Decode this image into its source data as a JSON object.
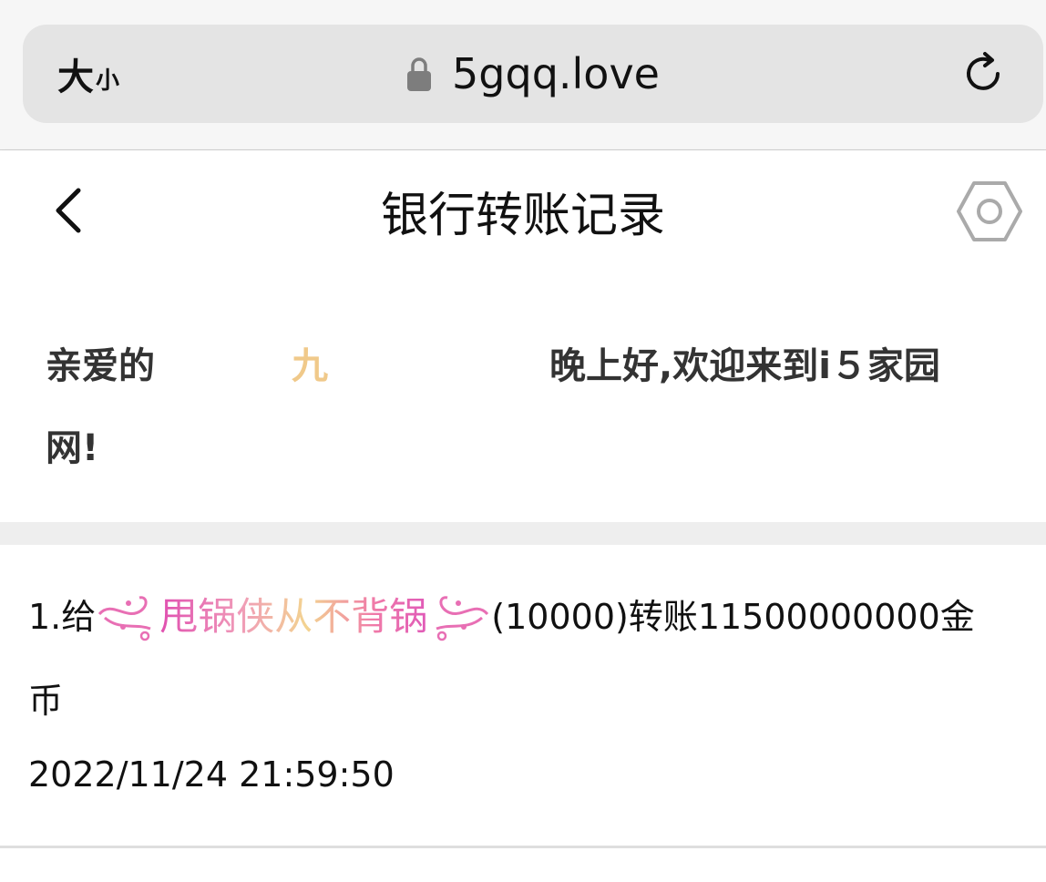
{
  "browser": {
    "text_size_big": "大",
    "text_size_small": "小",
    "url": "5gqq.love"
  },
  "header": {
    "title": "银行转账记录"
  },
  "greeting": {
    "prefix": "亲爱的",
    "name": "九",
    "suffix": "晚上好,欢迎来到i５家园",
    "line2": "网!"
  },
  "records": [
    {
      "index_prefix": "1.给",
      "recipient": "甩锅侠从不背锅",
      "detail": "(10000)转账11500000000金",
      "detail_cont": "币",
      "time": "2022/11/24 21:59:50"
    }
  ],
  "colors": {
    "name_color": "#f0c98a",
    "recipient_gradient": [
      "#e04fb0",
      "#f3d490",
      "#e05ab8"
    ]
  }
}
